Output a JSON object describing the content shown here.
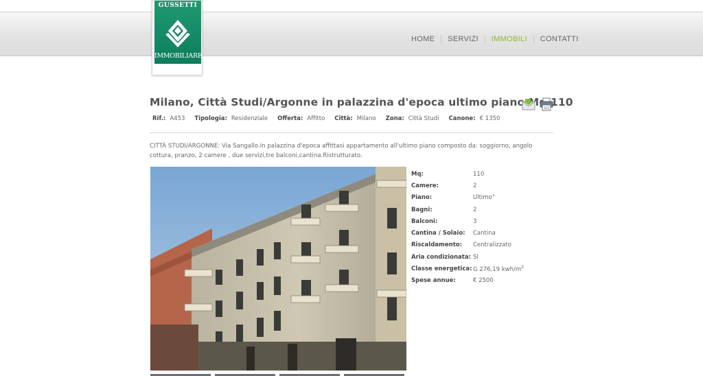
{
  "logo": {
    "top_text": "GUSSETTI",
    "bottom_text": "IMMOBILIARE"
  },
  "nav": {
    "items": [
      {
        "label": "HOME",
        "active": false
      },
      {
        "label": "SERVIZI",
        "active": false
      },
      {
        "label": "IMMOBILI",
        "active": true
      },
      {
        "label": "CONTATTI",
        "active": false
      }
    ],
    "active_color": "#8ab82e"
  },
  "listing": {
    "title": "Milano, Città Studi/Argonne in palazzina d'epoca ultimo piano Mq 110",
    "icons": [
      "email-icon",
      "print-icon"
    ],
    "meta": [
      {
        "label": "Rif.:",
        "value": "A453"
      },
      {
        "label": "Tipologia:",
        "value": "Residenziale"
      },
      {
        "label": "Offerta:",
        "value": "Affitto"
      },
      {
        "label": "Città:",
        "value": "Milano"
      },
      {
        "label": "Zona:",
        "value": "Città Studi"
      },
      {
        "label": "Canone:",
        "value": "€  1350"
      }
    ],
    "description": "CITTÀ STUDI/ARGONNE: Via Sangallo.In palazzina d'epoca affittasi appartamento all'ultimo piano composto da: soggiorno, angolo cottura, pranzo, 2 camere , due servizi,tre balconi,cantina.Ristrutturato.",
    "details": [
      {
        "label": "Mq:",
        "value": "110"
      },
      {
        "label": "Camere:",
        "value": "2"
      },
      {
        "label": "Piano:",
        "value": "Ultimo°"
      },
      {
        "label": "Bagni:",
        "value": "2"
      },
      {
        "label": "Balconi:",
        "value": "3"
      },
      {
        "label": "Cantina / Solaio:",
        "value": "Cantina"
      },
      {
        "label": "Riscaldamento:",
        "value": "Centralizzato"
      },
      {
        "label": "Aria condizionata:",
        "value": "SI"
      },
      {
        "label": "Classe energetica:",
        "value": "G 276,19 kwh/m",
        "sup": "2"
      },
      {
        "label": "Spese annue:",
        "value": "€ 2500"
      }
    ]
  }
}
